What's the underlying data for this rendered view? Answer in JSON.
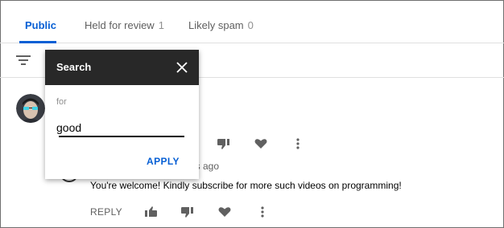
{
  "tabs": [
    {
      "label": "Public",
      "count": ""
    },
    {
      "label": "Held for review",
      "count": "1"
    },
    {
      "label": "Likely spam",
      "count": "0"
    }
  ],
  "accent_color": "#065fd4",
  "search_popup": {
    "title": "Search",
    "for_label": "for",
    "query": "good",
    "apply_label": "APPLY"
  },
  "reply": {
    "time_partial": "es ago",
    "text": "You're welcome! Kindly subscribe for more such videos on programming!",
    "reply_label": "REPLY"
  },
  "icons": [
    "filter-icon",
    "close-icon",
    "thumb-up-icon",
    "thumb-down-icon",
    "heart-icon",
    "more-vert-icon"
  ]
}
